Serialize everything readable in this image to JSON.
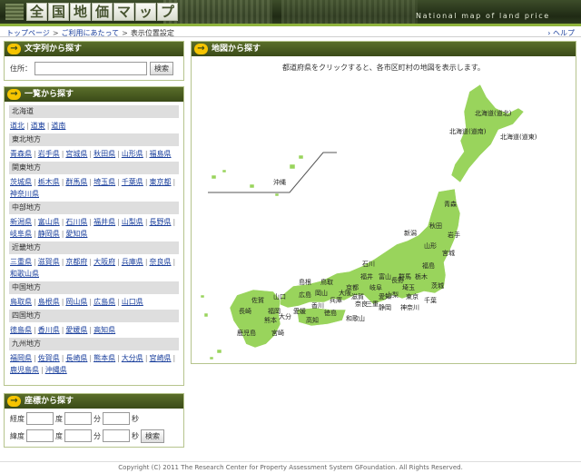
{
  "header": {
    "logo_chars": [
      "全",
      "国",
      "地",
      "価",
      "マ",
      "ッ",
      "プ"
    ],
    "tagline": "National map of land price"
  },
  "breadcrumb": {
    "items": [
      "トップページ",
      "ご利用にあたって"
    ],
    "current": "表示位置設定",
    "help": "ヘルプ"
  },
  "text_search": {
    "title": "文字列から探す",
    "address_label": "住所：",
    "address_value": "",
    "search_button": "検索"
  },
  "list_search": {
    "title": "一覧から探す",
    "regions": [
      {
        "name": "北海道",
        "prefs": [
          "道北",
          "道東",
          "道南"
        ]
      },
      {
        "name": "東北地方",
        "prefs": [
          "青森県",
          "岩手県",
          "宮城県",
          "秋田県",
          "山形県",
          "福島県"
        ]
      },
      {
        "name": "関東地方",
        "prefs": [
          "茨城県",
          "栃木県",
          "群馬県",
          "埼玉県",
          "千葉県",
          "東京都",
          "神奈川県"
        ]
      },
      {
        "name": "中部地方",
        "prefs": [
          "新潟県",
          "富山県",
          "石川県",
          "福井県",
          "山梨県",
          "長野県",
          "岐阜県",
          "静岡県",
          "愛知県"
        ]
      },
      {
        "name": "近畿地方",
        "prefs": [
          "三重県",
          "滋賀県",
          "京都府",
          "大阪府",
          "兵庫県",
          "奈良県",
          "和歌山県"
        ]
      },
      {
        "name": "中国地方",
        "prefs": [
          "鳥取県",
          "島根県",
          "岡山県",
          "広島県",
          "山口県"
        ]
      },
      {
        "name": "四国地方",
        "prefs": [
          "徳島県",
          "香川県",
          "愛媛県",
          "高知県"
        ]
      },
      {
        "name": "九州地方",
        "prefs": [
          "福岡県",
          "佐賀県",
          "長崎県",
          "熊本県",
          "大分県",
          "宮崎県",
          "鹿児島県",
          "沖縄県"
        ]
      }
    ]
  },
  "coord_search": {
    "title": "座標から探す",
    "lat_label": "経度",
    "lon_label": "緯度",
    "deg": "度",
    "min": "分",
    "sec": "秒",
    "search_button": "検索"
  },
  "map_search": {
    "title": "地図から探す",
    "instruction": "都道府県をクリックすると、各市区町村の地図を表示します。",
    "labels": [
      "北海道(道北)",
      "北海道(道南)",
      "北海道(道東)",
      "沖縄",
      "青森",
      "秋田",
      "岩手",
      "山形",
      "宮城",
      "新潟",
      "福島",
      "石川",
      "富山",
      "福井",
      "長野",
      "群馬",
      "栃木",
      "茨城",
      "岐阜",
      "山梨",
      "埼玉",
      "東京",
      "千葉",
      "神奈川",
      "静岡",
      "愛知",
      "滋賀",
      "京都",
      "三重",
      "奈良",
      "大阪",
      "和歌山",
      "兵庫",
      "鳥取",
      "島根",
      "岡山",
      "広島",
      "山口",
      "香川",
      "徳島",
      "愛媛",
      "高知",
      "福岡",
      "佐賀",
      "長崎",
      "大分",
      "熊本",
      "宮崎",
      "鹿児島"
    ],
    "map_color": "#99d45c"
  },
  "footer": "Copyright (C) 2011 The Research Center for Property Assessment System GFoundation. All Rights Reserved."
}
